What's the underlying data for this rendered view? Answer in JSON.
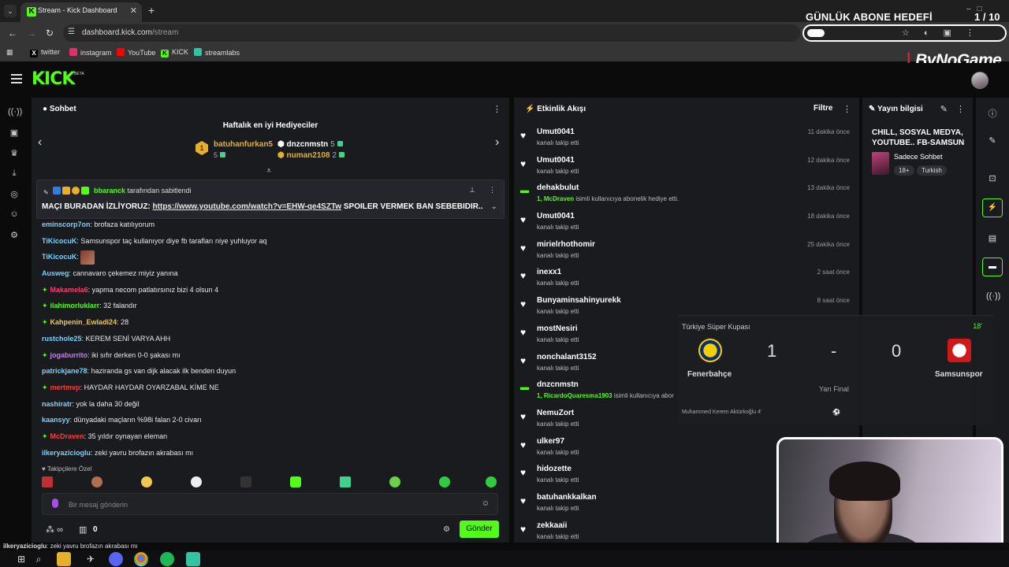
{
  "browser": {
    "tab_title": "Stream - Kick Dashboard",
    "tab_close": "✕",
    "new_tab": "+",
    "url_host": "dashboard.kick.com",
    "url_path": "/stream",
    "bookmarks": [
      {
        "label": "twitter",
        "color": "#ffffff"
      },
      {
        "label": "instagram",
        "color": "#e1306c"
      },
      {
        "label": "YouTube",
        "color": "#ff0000"
      },
      {
        "label": "KICK",
        "color": "#53fc18"
      },
      {
        "label": "streamlabs",
        "color": "#31c3a2"
      }
    ]
  },
  "overlay": {
    "goal_title": "GÜNLÜK ABONE HEDEFİ",
    "goal_count": "1  / 10",
    "goal_progress": 0.1,
    "brand_name": "ByNoGame"
  },
  "kick": {
    "logo": "KICK",
    "beta": "BETA"
  },
  "chat": {
    "title": "Sohbet",
    "gift_title": "Haftalık en iyi Hediyeciler",
    "gifters": [
      {
        "name": "batuhanfurkan5",
        "count": "5",
        "color": "#e7b02a"
      },
      {
        "name": "dnzcnmstn",
        "count": "5",
        "color": "#ffffff"
      },
      {
        "name": "numan2108",
        "count": "2",
        "color": "#e7b02a"
      }
    ],
    "pinned_by_user": "bbaranck",
    "pinned_by_suffix": "tarafından sabitlendi",
    "pinned_prefix": "MAÇI BURADAN İZLİYORUZ:",
    "pinned_link": "https://www.youtube.com/watch?v=EHW-qe4SZTw",
    "pinned_suffix": "SPOILER VERMEK BAN SEBEBIDIR..",
    "messages": [
      {
        "user": "eminscorp7on",
        "color": "#7ad1ff",
        "text": "brofaza katılıyorum",
        "badge": false
      },
      {
        "user": "TiKicocuK",
        "color": "#7ad1ff",
        "text": "Samsunspor taç kullanıyor diye fb tarafları niye yuhluyor aq",
        "badge": false
      },
      {
        "user": "TiKicocuK",
        "color": "#7ad1ff",
        "text": "",
        "badge": false,
        "emote": true
      },
      {
        "user": "Ausweg",
        "color": "#7ad1ff",
        "text": "cannavaro çekemez miyiz yanına",
        "badge": false
      },
      {
        "user": "Makamela6",
        "color": "#ff3b6b",
        "text": "yapma necom patlatırsınız bizi 4 olsun 4",
        "badge": true
      },
      {
        "user": "ilahimorluklarr",
        "color": "#53fc18",
        "text": "32 falandır",
        "badge": true
      },
      {
        "user": "Kahpenin_Ewladi24",
        "color": "#f2c94c",
        "text": "28",
        "badge": true
      },
      {
        "user": "rustchole25",
        "color": "#7ad1ff",
        "text": "KEREM SENİ VARYA AHH",
        "badge": false
      },
      {
        "user": "jogaburrito",
        "color": "#c77dff",
        "text": "iki sıfır derken 0-0 şakası mı",
        "badge": true
      },
      {
        "user": "patrickjane78",
        "color": "#7ad1ff",
        "text": "haziranda gs van dijk alacak ilk benden duyun",
        "badge": false
      },
      {
        "user": "mertmvp",
        "color": "#ff3b3b",
        "text": "HAYDAR HAYDAR OYARZABAL KİME NE",
        "badge": true
      },
      {
        "user": "nashiratr",
        "color": "#7ad1ff",
        "text": "yok la daha 30 değil",
        "badge": false
      },
      {
        "user": "kaansyy",
        "color": "#7ad1ff",
        "text": "dünyadaki maçların %98i falan 2-0 civarı",
        "badge": false
      },
      {
        "user": "McDraven",
        "color": "#ff3b3b",
        "text": "35 yıldır oynayan eleman",
        "badge": true
      },
      {
        "user": "ilkeryazicioglu",
        "color": "#7ad1ff",
        "text": "zeki yavru brofazın akrabası mı",
        "badge": false
      }
    ],
    "followers_only": "Takipçilere Özel",
    "input_placeholder": "Bir mesaj gönderin",
    "viewer_icon_label": "∞",
    "gift_count": "0",
    "send_label": "Gönder"
  },
  "activity": {
    "title": "Etkinlik Akışı",
    "filter_label": "Filtre",
    "items": [
      {
        "user": "Umut0041",
        "desc": "kanalı takip etti",
        "time": "11 dakika önce",
        "type": "follow"
      },
      {
        "user": "Umut0041",
        "desc": "kanalı takip etti",
        "time": "12 dakika önce",
        "type": "follow"
      },
      {
        "user": "dehakbulut",
        "desc_highlight": "1, McDraven",
        "desc": "isimli kullanıcıya abonelik hediye etti.",
        "time": "13 dakika önce",
        "type": "gift"
      },
      {
        "user": "Umut0041",
        "desc": "kanalı takip etti",
        "time": "18 dakika önce",
        "type": "follow"
      },
      {
        "user": "mirielrhothomir",
        "desc": "kanalı takip etti",
        "time": "25 dakika önce",
        "type": "follow"
      },
      {
        "user": "inexx1",
        "desc": "kanalı takip etti",
        "time": "2 saat önce",
        "type": "follow"
      },
      {
        "user": "Bunyaminsahinyurekk",
        "desc": "kanalı takip etti",
        "time": "8 saat önce",
        "type": "follow"
      },
      {
        "user": "mostNesiri",
        "desc": "kanalı takip etti",
        "time": "",
        "type": "follow"
      },
      {
        "user": "nonchalant3152",
        "desc": "kanalı takip etti",
        "time": "",
        "type": "follow"
      },
      {
        "user": "dnzcnmstn",
        "desc_highlight": "1, RicardoQuaresma1903",
        "desc": "isimli kullanıcıya abor",
        "time": "",
        "type": "gift"
      },
      {
        "user": "NemuZort",
        "desc": "kanalı takip etti",
        "time": "",
        "type": "follow"
      },
      {
        "user": "ulker97",
        "desc": "kanalı takip etti",
        "time": "",
        "type": "follow"
      },
      {
        "user": "hidozette",
        "desc": "kanalı takip etti",
        "time": "",
        "type": "follow"
      },
      {
        "user": "batuhankkalkan",
        "desc": "kanalı takip etti",
        "time": "",
        "type": "follow"
      },
      {
        "user": "zekkaaii",
        "desc": "kanalı takip etti",
        "time": "",
        "type": "follow"
      }
    ]
  },
  "stream_info": {
    "title": "Yayın bilgisi",
    "stream_title": "CHILL, SOSYAL MEDYA, YOUTUBE.. FB-SAMSUN",
    "category": "Sadece Sohbet",
    "tags": [
      "18+",
      "Turkish"
    ]
  },
  "scoreboard": {
    "league": "Türkiye Süper Kupası",
    "minute": "18'",
    "home_team": "Fenerbahçe",
    "away_team": "Samsunspor",
    "home_score": "1",
    "separator": "-",
    "away_score": "0",
    "stage": "Yarı Final",
    "scorer": "Muhammed Kerem Aktürkoğlu 4'"
  },
  "ticker": {
    "user": "ilkeryazicioglu",
    "text": ": zeki yavru brofazın akrabası mı"
  }
}
